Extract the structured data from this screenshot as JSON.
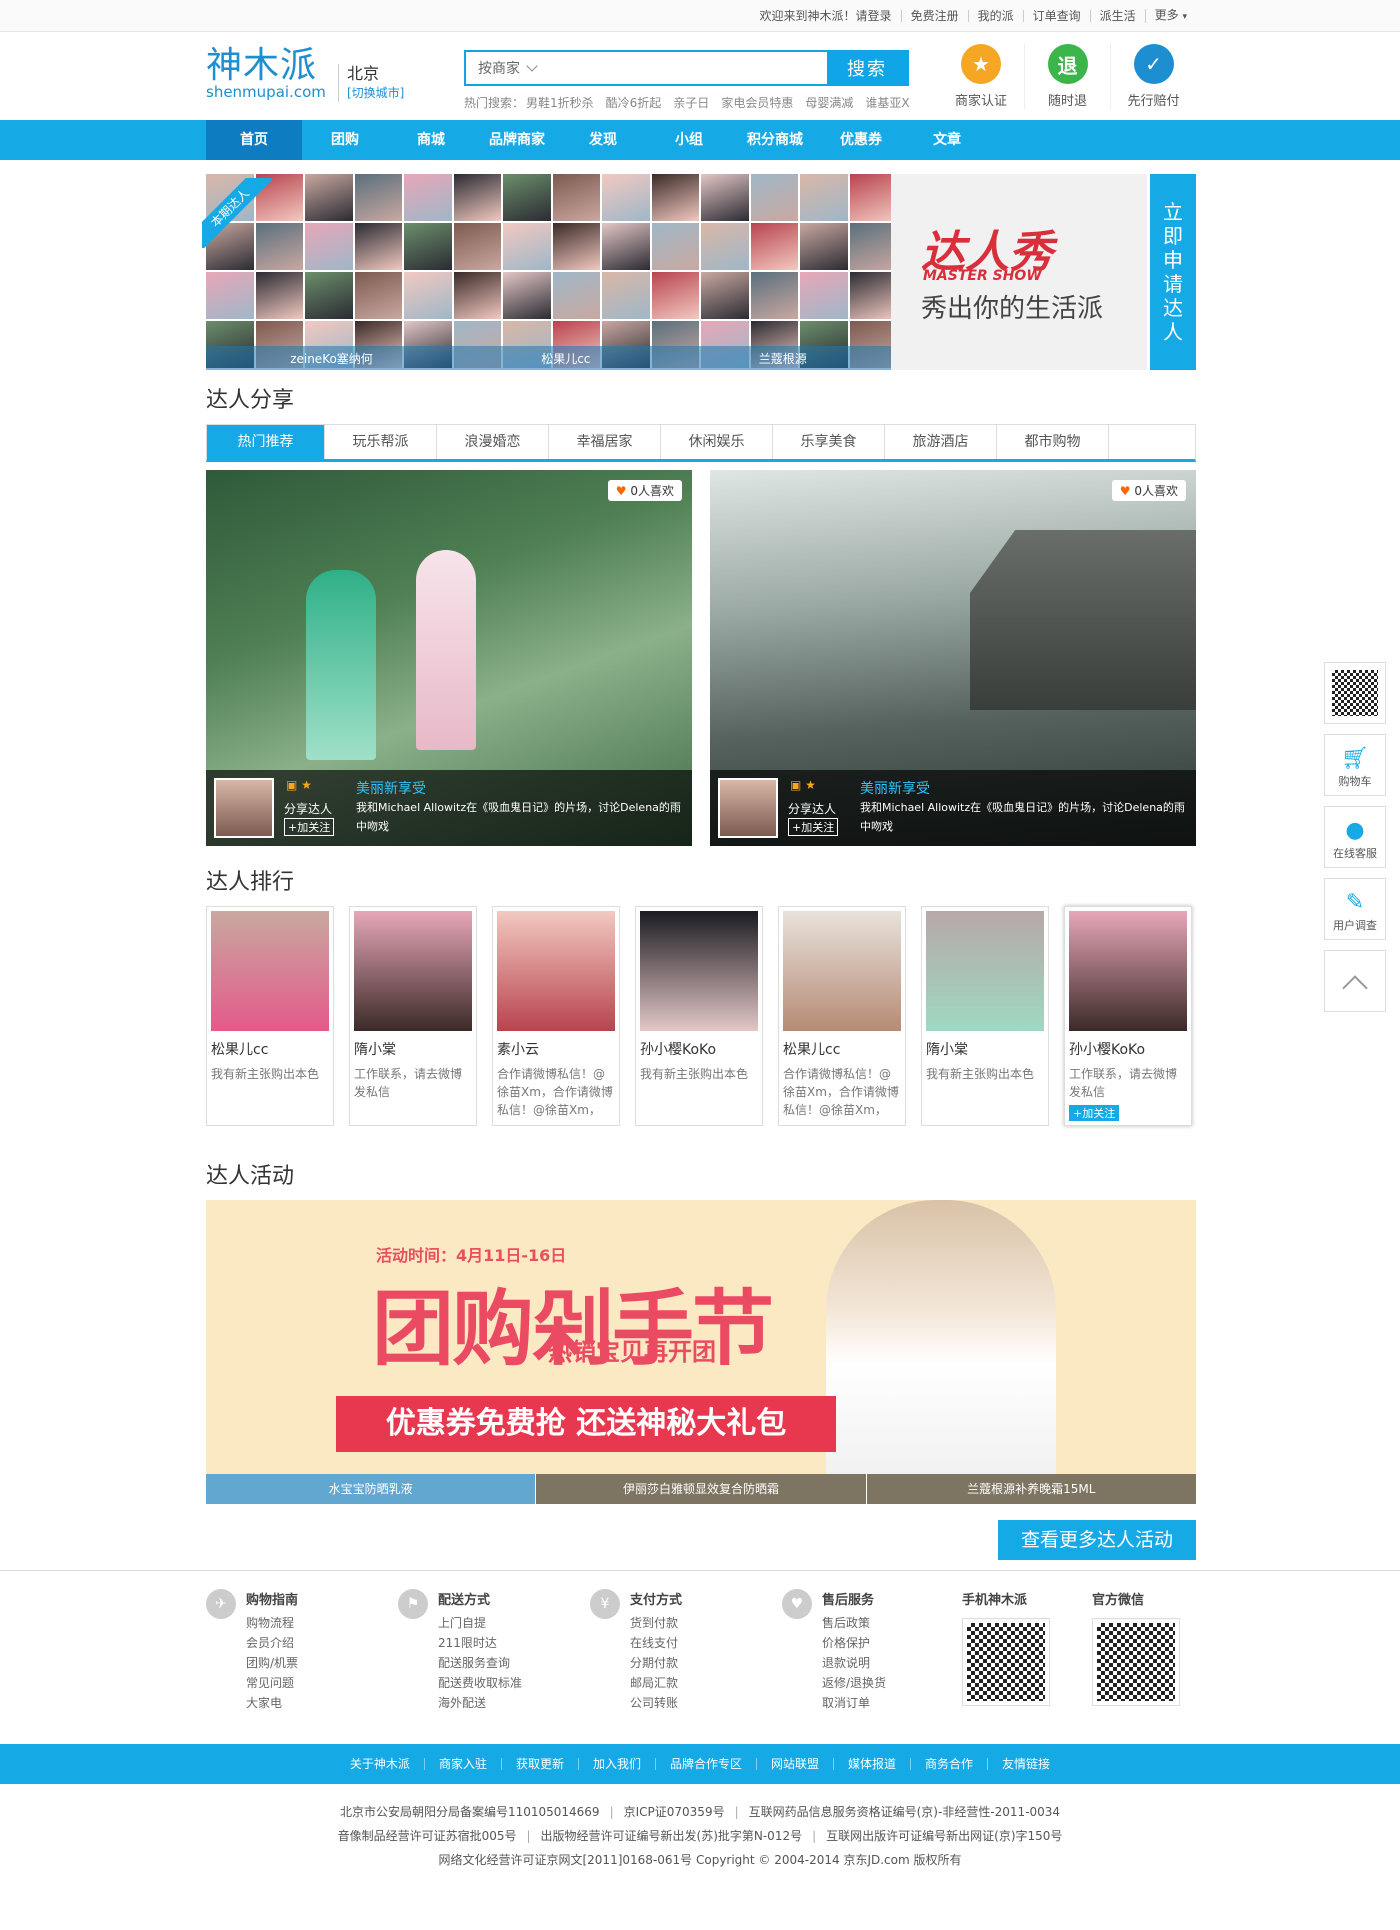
{
  "topbar": {
    "links": [
      "欢迎来到神木派！请登录",
      "免费注册",
      "我的派",
      "订单查询",
      "派生活",
      "更多"
    ]
  },
  "header": {
    "logo_cn": "神木派",
    "logo_en": "shenmupai.com",
    "city": "北京",
    "city_switch": "[切换城市]",
    "search_select": "按商家",
    "search_button": "搜索",
    "hot_label": "热门搜索：",
    "hot_terms": [
      "男鞋1折秒杀",
      "酷冷6折起",
      "亲子日",
      "家电会员特惠",
      "母婴满减",
      "谁基亚X"
    ],
    "badges": [
      {
        "label": "商家认证",
        "icon": "star-badge-icon",
        "glyph": "★",
        "color": "#f5a623"
      },
      {
        "label": "随时退",
        "icon": "refund-badge-icon",
        "glyph": "退",
        "color": "#3bb54a"
      },
      {
        "label": "先行赔付",
        "icon": "shield-badge-icon",
        "glyph": "✓",
        "color": "#1d8fd0"
      }
    ]
  },
  "nav": {
    "items": [
      "首页",
      "团购",
      "商城",
      "品牌商家",
      "发现",
      "小组",
      "积分商城",
      "优惠券",
      "文章"
    ]
  },
  "banner": {
    "ribbon": "本期达人",
    "names": [
      "zeineKo塞纳何",
      "松果儿cc",
      "兰蔻根源"
    ],
    "promo_title": "达人秀",
    "promo_sub": "MASTER SHOW",
    "promo_slogan": "秀出你的生活派",
    "apply": "立即申请达人"
  },
  "share": {
    "title": "达人分享",
    "tabs": [
      "热门推荐",
      "玩乐帮派",
      "浪漫婚恋",
      "幸福居家",
      "休闲娱乐",
      "乐享美食",
      "旅游酒店",
      "都市购物"
    ],
    "cards": [
      {
        "likes": "0人喜欢",
        "role": "分享达人",
        "follow": "+加关注",
        "title": "美丽新享受",
        "desc": "我和Michael Allowitz在《吸血鬼日记》的片场，讨论Delena的雨中吻戏"
      },
      {
        "likes": "0人喜欢",
        "role": "分享达人",
        "follow": "+加关注",
        "title": "美丽新享受",
        "desc": "我和Michael Allowitz在《吸血鬼日记》的片场，讨论Delena的雨中吻戏"
      }
    ]
  },
  "rank": {
    "title": "达人排行",
    "people": [
      {
        "name": "松果儿cc",
        "desc": "我有新主张购出本色"
      },
      {
        "name": "隋小棠",
        "desc": "工作联系，请去微博发私信"
      },
      {
        "name": "素小云",
        "desc": "合作请微博私信！@徐苗Xm，合作请微博私信！@徐苗Xm，"
      },
      {
        "name": "孙小樱KoKo",
        "desc": "我有新主张购出本色"
      },
      {
        "name": "松果儿cc",
        "desc": "合作请微博私信！@徐苗Xm，合作请微博私信！@徐苗Xm，"
      },
      {
        "name": "隋小棠",
        "desc": "我有新主张购出本色"
      },
      {
        "name": "孙小樱KoKo",
        "desc": "工作联系，请去微博发私信",
        "follow": "+加关注"
      }
    ]
  },
  "activity": {
    "title": "达人活动",
    "time": "活动时间：4月11日-16日",
    "headline": "团购剁手节",
    "subline": "热销宝贝再开团",
    "ribbon": "优惠券免费抢 还送神秘大礼包",
    "captions": [
      "水宝宝防晒乳液",
      "伊丽莎白雅顿显效复合防晒霜",
      "兰蔻根源补养晚霜15ML"
    ],
    "more": "查看更多达人活动"
  },
  "service": {
    "cols": [
      {
        "title": "购物指南",
        "icon": "guide-icon",
        "glyph": "✈",
        "items": [
          "购物流程",
          "会员介绍",
          "团购/机票",
          "常见问题",
          "大家电"
        ]
      },
      {
        "title": "配送方式",
        "icon": "delivery-icon",
        "glyph": "⚑",
        "items": [
          "上门自提",
          "211限时达",
          "配送服务查询",
          "配送费收取标准",
          "海外配送"
        ]
      },
      {
        "title": "支付方式",
        "icon": "payment-icon",
        "glyph": "¥",
        "items": [
          "货到付款",
          "在线支付",
          "分期付款",
          "邮局汇款",
          "公司转账"
        ]
      },
      {
        "title": "售后服务",
        "icon": "aftersale-icon",
        "glyph": "♥",
        "items": [
          "售后政策",
          "价格保护",
          "退款说明",
          "返修/退换货",
          "取消订单"
        ]
      }
    ],
    "qr_mobile": "手机神木派",
    "qr_wechat": "官方微信"
  },
  "footer_nav": [
    "关于神木派",
    "商家入驻",
    "获取更新",
    "加入我们",
    "品牌合作专区",
    "网站联盟",
    "媒体报道",
    "商务合作",
    "友情链接"
  ],
  "copyright": {
    "line1": [
      "北京市公安局朝阳分局备案编号110105014669",
      "京ICP证070359号",
      "互联网药品信息服务资格证编号(京)-非经营性-2011-0034"
    ],
    "line2": [
      "音像制品经营许可证苏宿批005号",
      "出版物经营许可证编号新出发(苏)批字第N-012号",
      "互联网出版许可证编号新出网证(京)字150号"
    ],
    "line3": "网络文化经营许可证京网文[2011]0168-061号   Copyright © 2004-2014   京东JD.com 版权所有"
  },
  "side": {
    "buttons": [
      "购物车",
      "在线客服",
      "用户调查"
    ]
  },
  "colors": {
    "accent": "#15aae6",
    "nav_active": "#0d7cc0",
    "promo_red": "#d92f3b"
  }
}
